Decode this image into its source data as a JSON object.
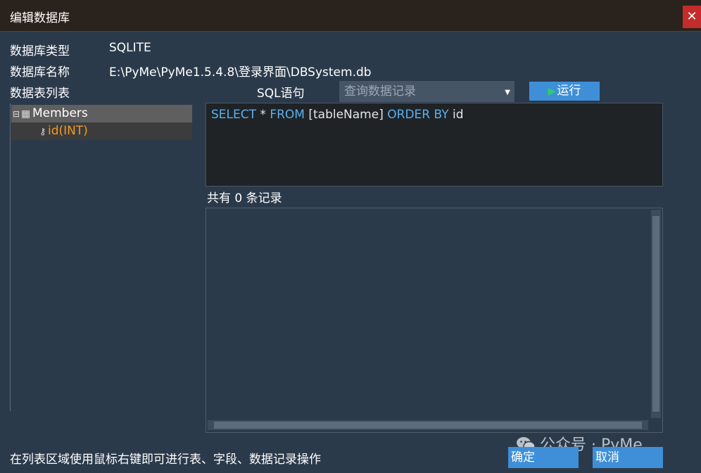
{
  "window": {
    "title": "编辑数据库",
    "close_glyph": "✕"
  },
  "db_info": {
    "type_label": "数据库类型",
    "type_value": "SQLITE",
    "name_label": "数据库名称",
    "name_value": "E:\\PyMe\\PyMe1.5.4.8\\登录界面\\DBSystem.db",
    "tables_label": "数据表列表"
  },
  "sql": {
    "label": "SQL语句",
    "preset": "查询数据记录",
    "run_label": "运行",
    "query_tokens": [
      {
        "text": "SELECT",
        "kind": "keyword"
      },
      {
        "text": " * ",
        "kind": "text"
      },
      {
        "text": "FROM",
        "kind": "keyword"
      },
      {
        "text": " [tableName] ",
        "kind": "text"
      },
      {
        "text": "ORDER BY",
        "kind": "keyword"
      },
      {
        "text": " id",
        "kind": "text"
      }
    ]
  },
  "tree": {
    "root": {
      "expander": "⊟",
      "label": "Members",
      "icon": "table-icon"
    },
    "child": {
      "label": "id(INT)",
      "icon": "key-icon"
    }
  },
  "results": {
    "count_text": "共有 0 条记录"
  },
  "footer": {
    "hint": "在列表区域使用鼠标右键即可进行表、字段、数据记录操作"
  },
  "buttons": {
    "ok": "确定",
    "cancel": "取消"
  },
  "watermark": {
    "text": "公众号 · PyMe"
  },
  "colors": {
    "background": "#2b3a4b",
    "titlebar": "#2a221c",
    "accent_button": "#3f8fd8",
    "keyword": "#5ab0f0",
    "field_text": "#f09a24",
    "close": "#c42b2b"
  }
}
